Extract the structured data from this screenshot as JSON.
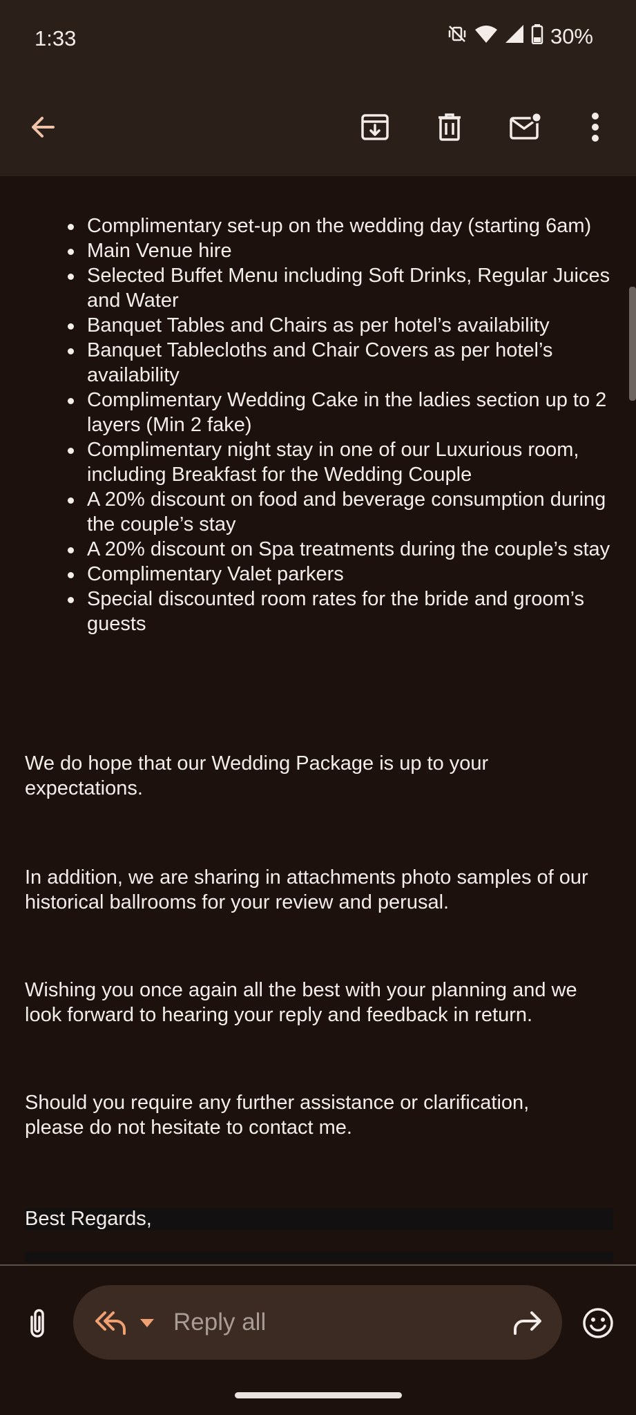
{
  "status_bar": {
    "time": "1:33",
    "battery": "30%",
    "icons": [
      "vibrate-off-icon",
      "wifi-icon",
      "signal-icon",
      "battery-icon"
    ]
  },
  "toolbar": {
    "back_icon": "arrow-left-icon",
    "actions": [
      "archive-icon",
      "delete-icon",
      "mark-unread-icon",
      "more-vert-icon"
    ]
  },
  "email": {
    "bullets": [
      "Complimentary set-up on the wedding day (starting 6am)",
      "Main Venue hire",
      "Selected Buffet Menu including Soft Drinks, Regular Juices and Water",
      "Banquet Tables and Chairs as per hotel’s availability",
      "Banquet Tablecloths and Chair Covers as per hotel’s availability",
      "Complimentary Wedding Cake in the ladies section up to 2 layers (Min 2 fake)",
      "Complimentary night stay in one of our Luxurious room, including Breakfast for the Wedding Couple",
      "A 20% discount on food and beverage consumption during the couple’s stay",
      "A 20% discount on Spa treatments during the couple’s stay",
      "Complimentary Valet parkers",
      "Special discounted room rates for the bride and groom’s guests"
    ],
    "paragraphs": [
      "We do hope that our Wedding Package is up to your expectations.",
      "In addition, we are sharing in attachments photo samples of our historical ballrooms for your review and perusal.",
      "Wishing you once again all the best with your planning and we look forward to hearing your reply and feedback in return.",
      "Should you require any further assistance or clarification, please do not hesitate to contact me."
    ],
    "signoff": "Best Regards,"
  },
  "reply_bar": {
    "reply_all_label": "Reply all",
    "icons": [
      "attach-icon",
      "reply-all-icon",
      "chevron-down-icon",
      "forward-icon",
      "emoji-icon"
    ],
    "accent_color": "#f0a172"
  }
}
